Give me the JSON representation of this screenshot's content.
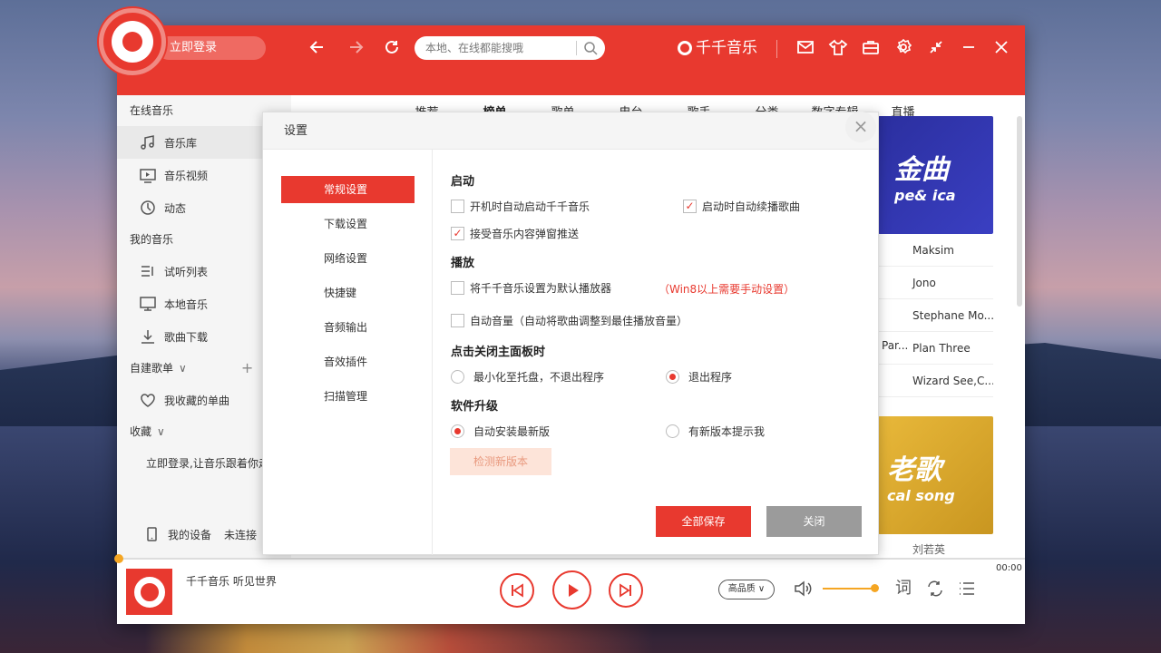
{
  "app": {
    "login_label": "立即登录",
    "search_placeholder": "本地、在线都能搜哦",
    "brand": "千千音乐"
  },
  "nav_tabs": [
    "推荐",
    "榜单",
    "歌单",
    "电台",
    "歌手",
    "分类",
    "数字专辑",
    "直播"
  ],
  "sidebar": {
    "online_music": "在线音乐",
    "items_online": [
      {
        "label": "音乐库",
        "icon": "music-note-icon"
      },
      {
        "label": "音乐视频",
        "icon": "video-icon"
      },
      {
        "label": "动态",
        "icon": "activity-icon"
      }
    ],
    "my_music": "我的音乐",
    "items_mine": [
      {
        "label": "试听列表",
        "icon": "list-icon"
      },
      {
        "label": "本地音乐",
        "icon": "monitor-icon"
      },
      {
        "label": "歌曲下载",
        "icon": "download-icon"
      }
    ],
    "created_playlists": "自建歌单",
    "favorite_songs": "我收藏的单曲",
    "collections": "收藏",
    "login_note": "立即登录,让音乐跟着你走",
    "my_device": "我的设备",
    "device_status": "未连接"
  },
  "content": {
    "card_blue_text": "金曲",
    "card_blue_sub": "pe& ica",
    "card_gold_text": "老歌",
    "card_gold_sub": "cal song",
    "artists": [
      "Maksim",
      "Jono",
      "Stephane Mo...",
      "Plan Three",
      "Wizard See,C..."
    ],
    "ghost_partial": "Par...",
    "ghost_bottom": "刘若英"
  },
  "player": {
    "now_playing": "千千音乐 听见世界",
    "time": "00:00",
    "quality": "高品质",
    "lyrics_label": "词",
    "accent": "#e8392f",
    "volume_color": "#f5a623"
  },
  "dialog": {
    "title": "设置",
    "close_glyph": "×",
    "nav": [
      "常规设置",
      "下载设置",
      "网络设置",
      "快捷键",
      "音频输出",
      "音效插件",
      "扫描管理"
    ],
    "startup": {
      "heading": "启动",
      "auto_start": "开机时自动启动千千音乐",
      "auto_start_checked": false,
      "resume": "启动时自动续播歌曲",
      "resume_checked": true,
      "popup": "接受音乐内容弹窗推送",
      "popup_checked": true
    },
    "playback": {
      "heading": "播放",
      "default_player": "将千千音乐设置为默认播放器",
      "default_player_checked": false,
      "default_player_hint": "（Win8以上需要手动设置）",
      "auto_volume": "自动音量（自动将歌曲调整到最佳播放音量）",
      "auto_volume_checked": false
    },
    "close_behavior": {
      "heading": "点击关闭主面板时",
      "minimize": "最小化至托盘，不退出程序",
      "exit": "退出程序",
      "selected": "exit"
    },
    "upgrade": {
      "heading": "软件升级",
      "auto_install": "自动安装最新版",
      "notify": "有新版本提示我",
      "selected": "auto_install",
      "check_button": "检测新版本"
    },
    "save_all": "全部保存",
    "close": "关闭"
  }
}
